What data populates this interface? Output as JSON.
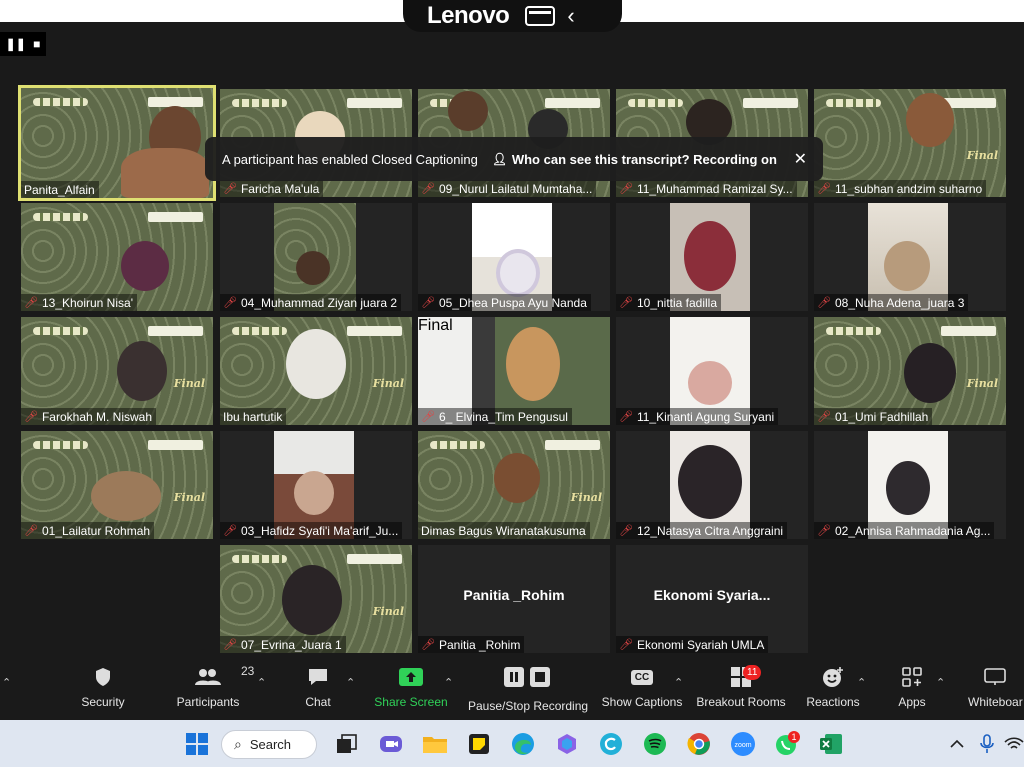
{
  "device": {
    "brand": "Lenovo"
  },
  "recording": {
    "pause_icon": "pause-icon",
    "stop_icon": "stop-icon"
  },
  "notification": {
    "message": "A participant has enabled Closed Captioning",
    "link": "Who can see this transcript? Recording on",
    "close": "✕"
  },
  "participants": {
    "p1": "Panita_Alfain",
    "p2": "Faricha Ma'ula",
    "p3": "09_Nurul Lailatul Mumtaha...",
    "p4": "11_Muhammad Ramizal Sy...",
    "p5": "11_subhan andzim suharno",
    "p6": "13_Khoirun Nisa'",
    "p7": "04_Muhammad Ziyan juara 2",
    "p8": "05_Dhea Puspa Ayu Nanda",
    "p9": "10_nittia fadilla",
    "p10": "08_Nuha Adena_juara 3",
    "p11": "Farokhah M. Niswah",
    "p12": "Ibu hartutik",
    "p13": "6_ Elvina_Tim Pengusul",
    "p14": "11_Kinanti Agung Suryani",
    "p15": "01_Umi Fadhillah",
    "p16": "01_Lailatur Rohmah",
    "p17": "03_Hafidz Syafi'i Ma'arif_Ju...",
    "p18": "Dimas Bagus Wiranatakusuma",
    "p19": "12_Natasya Citra Anggraini",
    "p20": "02_Annisa Rahmadania Ag...",
    "p21": "07_Evrina_Juara 1",
    "p22": "Panitia _Rohim",
    "p22_big": "Panitia _Rohim",
    "p23": "Ekonomi Syariah UMLA",
    "p23_big": "Ekonomi  Syaria..."
  },
  "banner_text": "Final",
  "toolbar": {
    "security": "Security",
    "participants": "Participants",
    "participants_count": "23",
    "chat": "Chat",
    "share": "Share Screen",
    "record": "Pause/Stop Recording",
    "captions": "Show Captions",
    "captions_icon_text": "CC",
    "breakout": "Breakout Rooms",
    "breakout_count": "11",
    "reactions": "Reactions",
    "apps": "Apps",
    "whiteboard": "Whiteboar"
  },
  "taskbar": {
    "search": "Search",
    "zoom_label": "zoom",
    "whatsapp_badge": "1"
  },
  "colors": {
    "active_border": "#dfe072",
    "share_green": "#30d158",
    "muted_mic": "#e04545"
  }
}
